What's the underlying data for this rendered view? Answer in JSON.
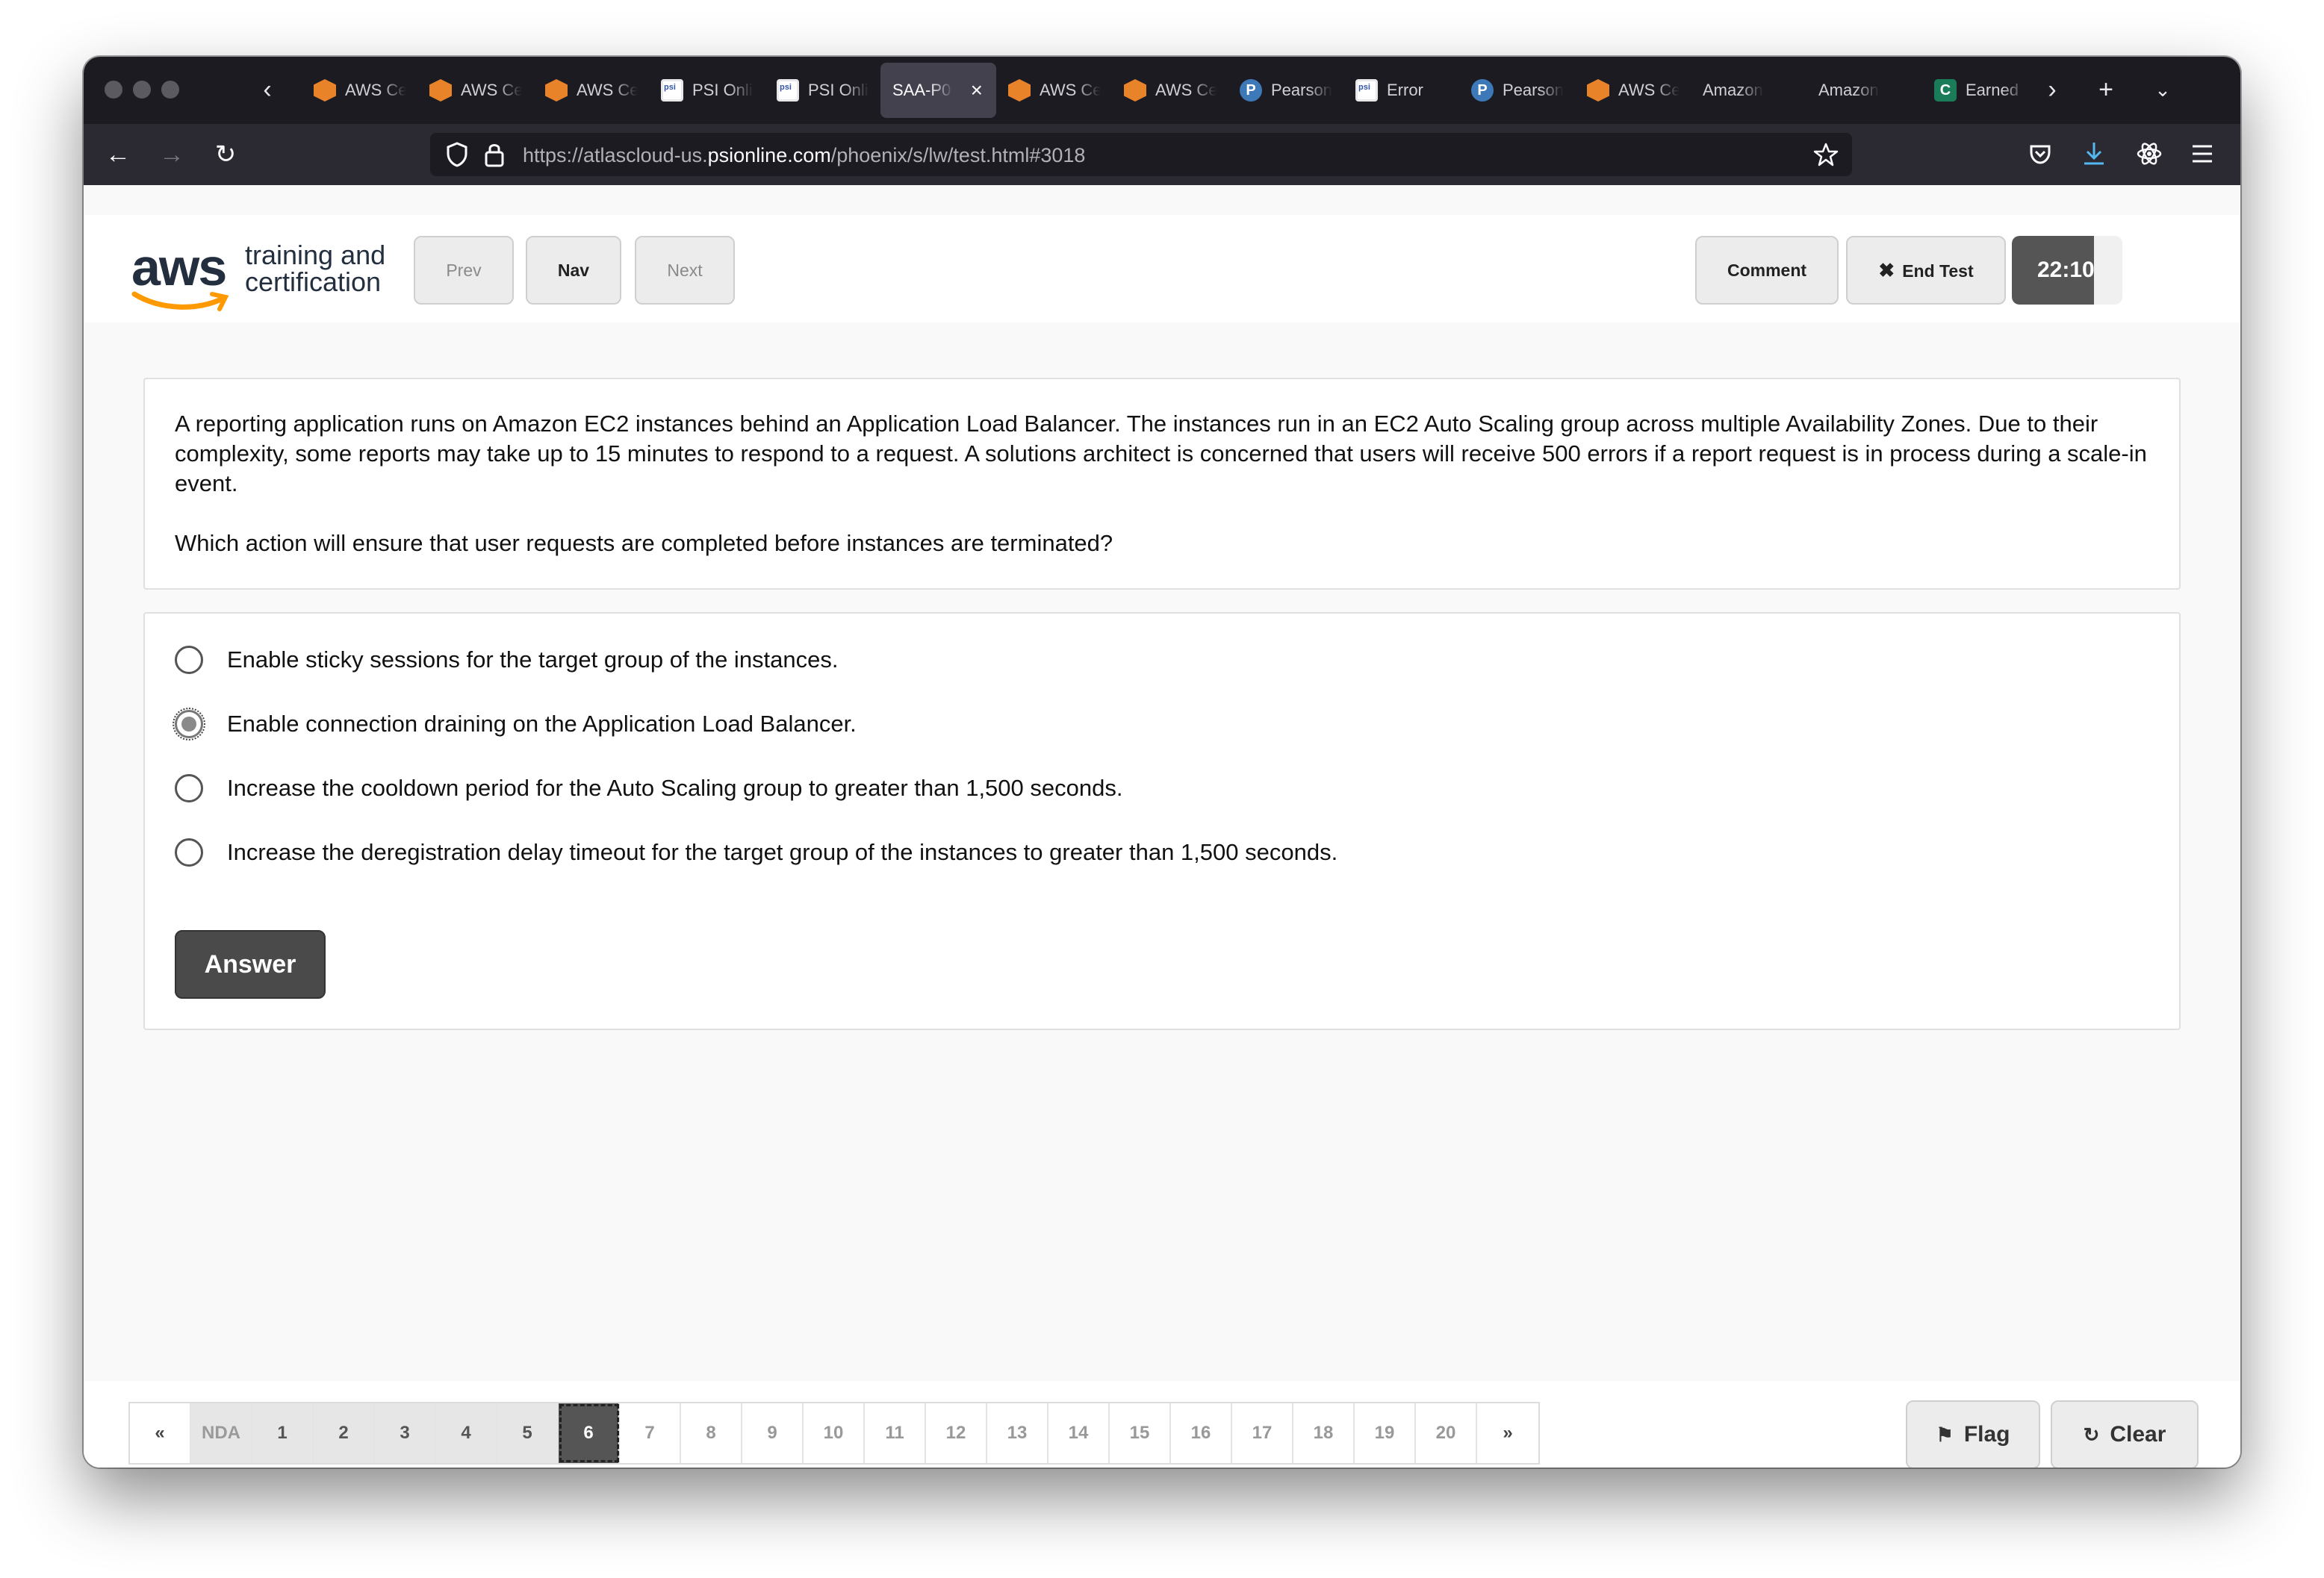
{
  "browser": {
    "tabs": [
      {
        "label": "AWS Certified",
        "icon": "aws-icon",
        "active": false
      },
      {
        "label": "AWS Certified",
        "icon": "aws-icon",
        "active": false
      },
      {
        "label": "AWS Certified",
        "icon": "aws-icon",
        "active": false
      },
      {
        "label": "PSI Online",
        "icon": "psi-icon",
        "active": false
      },
      {
        "label": "PSI Online",
        "icon": "psi-icon",
        "active": false
      },
      {
        "label": "SAA-P0",
        "icon": "",
        "active": true
      },
      {
        "label": "AWS Certified",
        "icon": "aws-icon",
        "active": false
      },
      {
        "label": "AWS Certified",
        "icon": "aws-icon",
        "active": false
      },
      {
        "label": "Pearson",
        "icon": "pearson-icon",
        "active": false
      },
      {
        "label": "Error",
        "icon": "psi-icon",
        "active": false
      },
      {
        "label": "Pearson",
        "icon": "pearson-icon",
        "active": false
      },
      {
        "label": "AWS Certified",
        "icon": "aws-icon",
        "active": false
      },
      {
        "label": "Amazon -",
        "icon": "",
        "active": false
      },
      {
        "label": "Amazon -",
        "icon": "",
        "active": false
      },
      {
        "label": "Earned",
        "icon": "credly-icon",
        "active": false
      }
    ],
    "url_prefix": "https://atlascloud-us.",
    "url_domain": "psionline.com",
    "url_suffix": "/phoenix/s/lw/test.html#3018"
  },
  "header": {
    "logo_word": "aws",
    "logo_line1": "training and",
    "logo_line2": "certification",
    "prev_label": "Prev",
    "nav_label": "Nav",
    "next_label": "Next",
    "comment_label": "Comment",
    "end_test_label": "End Test",
    "timer": "22:10"
  },
  "question": {
    "stem": "A reporting application runs on Amazon EC2 instances behind an Application Load Balancer. The instances run in an EC2 Auto Scaling group across multiple Availability Zones. Due to their complexity, some reports may take up to 15 minutes to respond to a request. A solutions architect is concerned that users will receive 500 errors if a report request is in process during a scale-in event.",
    "prompt": "Which action will ensure that user requests are completed before instances are terminated?",
    "options": [
      {
        "text": "Enable sticky sessions for the target group of the instances.",
        "selected": false
      },
      {
        "text": "Enable connection draining on the Application Load Balancer.",
        "selected": true
      },
      {
        "text": "Increase the cooldown period for the Auto Scaling group to greater than 1,500 seconds.",
        "selected": false
      },
      {
        "text": "Increase the deregistration delay timeout for the target group of the instances to greater than 1,500 seconds.",
        "selected": false
      }
    ],
    "answer_label": "Answer"
  },
  "footer": {
    "first_label": "«",
    "last_label": "»",
    "pages": [
      "NDA",
      "1",
      "2",
      "3",
      "4",
      "5",
      "6",
      "7",
      "8",
      "9",
      "10",
      "11",
      "12",
      "13",
      "14",
      "15",
      "16",
      "17",
      "18",
      "19",
      "20"
    ],
    "answered_count": 5,
    "current_page": "6",
    "flag_label": "Flag",
    "clear_label": "Clear"
  },
  "colors": {
    "tabstrip": "#1c1b22",
    "toolbar": "#2b2a33",
    "aws_orange": "#ff9900",
    "aws_navy": "#232f3e",
    "answer_button": "#4a4a4a"
  }
}
